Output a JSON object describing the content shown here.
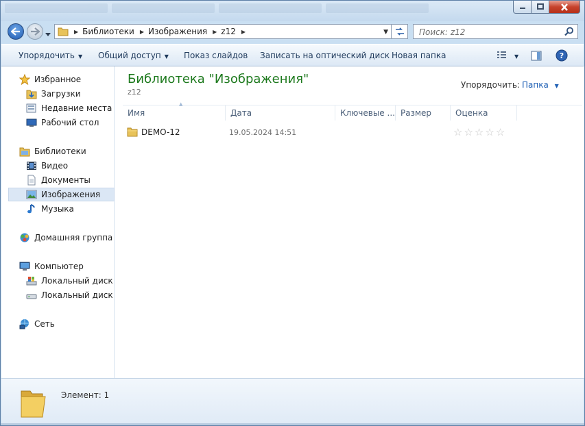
{
  "window": {
    "title_tabs": [
      "",
      "",
      "",
      ""
    ]
  },
  "address": {
    "crumbs": [
      "Библиотеки",
      "Изображения",
      "z12"
    ]
  },
  "search": {
    "placeholder": "Поиск: z12"
  },
  "toolbar": {
    "organize": "Упорядочить",
    "share": "Общий доступ",
    "slideshow": "Показ слайдов",
    "burn": "Записать на оптический диск",
    "new_folder": "Новая папка"
  },
  "nav": {
    "favorites": "Избранное",
    "downloads": "Загрузки",
    "recent": "Недавние места",
    "desktop": "Рабочий стол",
    "libraries": "Библиотеки",
    "video": "Видео",
    "documents": "Документы",
    "images": "Изображения",
    "music": "Музыка",
    "homegroup": "Домашняя группа",
    "computer": "Компьютер",
    "disk_c": "Локальный диск (C",
    "disk_d": "Локальный диск (D",
    "network": "Сеть"
  },
  "content": {
    "library_title": "Библиотека \"Изображения\"",
    "library_subtitle": "z12",
    "arrange_by_label": "Упорядочить:",
    "arrange_by_value": "Папка",
    "columns": [
      "Имя",
      "Дата",
      "Ключевые ...",
      "Размер",
      "Оценка"
    ],
    "rows": [
      {
        "name": "DEMO-12",
        "date": "19.05.2024 14:51",
        "rating_stars": 0
      }
    ]
  },
  "details": {
    "count": "Элемент: 1"
  },
  "colors": {
    "title_green": "#1e7a1e",
    "link_blue": "#1e5fb4",
    "selection": "#dbe7f5"
  }
}
